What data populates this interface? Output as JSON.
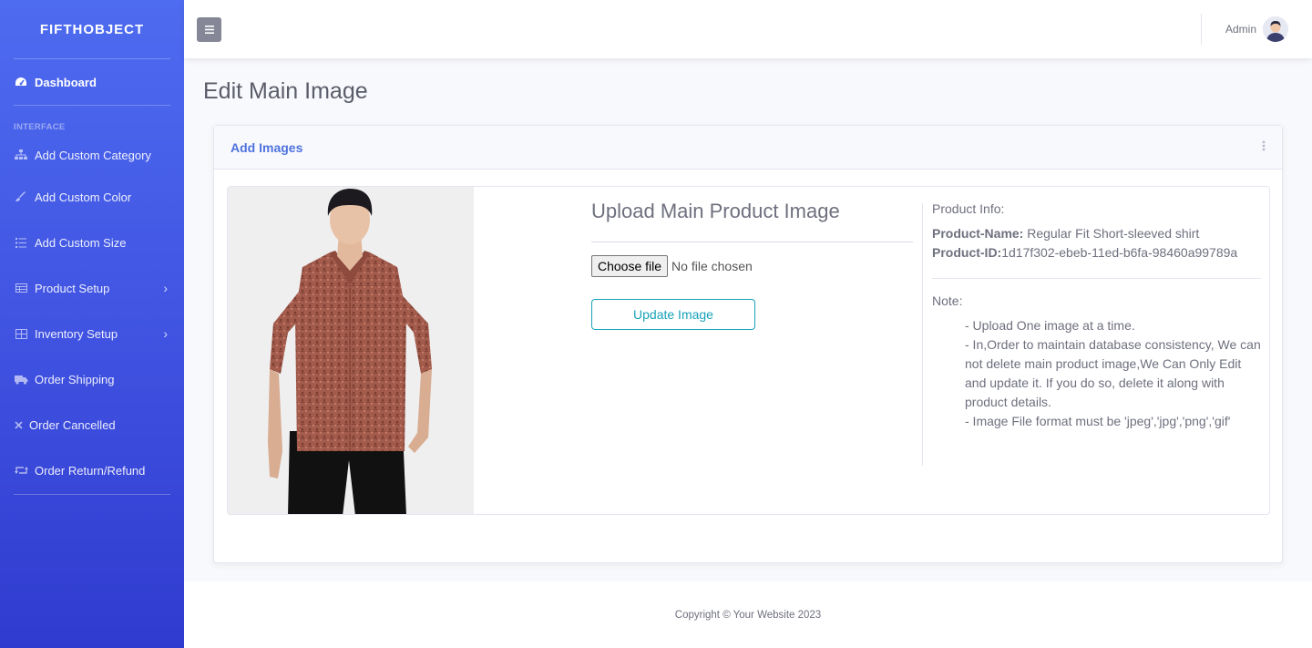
{
  "brand": "FIFTHOBJECT",
  "sidebar": {
    "dashboard": "Dashboard",
    "heading": "INTERFACE",
    "items": [
      {
        "label": "Add Custom Category",
        "icon": "sitemap-icon"
      },
      {
        "label": "Add Custom Color",
        "icon": "paint-brush-icon"
      },
      {
        "label": "Add Custom Size",
        "icon": "list-icon"
      },
      {
        "label": "Product Setup",
        "icon": "table-icon",
        "has_submenu": true
      },
      {
        "label": "Inventory Setup",
        "icon": "table-icon",
        "has_submenu": true
      },
      {
        "label": "Order Shipping",
        "icon": "truck-icon"
      },
      {
        "label": "Order Cancelled",
        "icon": "times-icon"
      },
      {
        "label": "Order Return/Refund",
        "icon": "retweet-icon"
      }
    ]
  },
  "topbar": {
    "user_name": "Admin"
  },
  "page": {
    "title": "Edit Main Image"
  },
  "card": {
    "title": "Add Images",
    "upload": {
      "title": "Upload Main Product Image",
      "choose_label": "Choose file",
      "no_file_label": "No file chosen",
      "update_label": "Update Image"
    },
    "info": {
      "heading": "Product Info:",
      "name_label": "Product-Name:",
      "name_value": " Regular Fit Short-sleeved shirt",
      "id_label": "Product-ID:",
      "id_value": "1d17f302-ebeb-11ed-b6fa-98460a99789a",
      "note_heading": "Note:",
      "notes": [
        "- Upload One image at a time.",
        "- In,Order to maintain database consistency, We can not delete main product image,We Can Only Edit and update it. If you do so, delete it along with product details.",
        "- Image File format must be 'jpeg','jpg','png','gif'"
      ]
    }
  },
  "footer": {
    "copyright": "Copyright © Your Website 2023"
  },
  "colors": {
    "sidebar_top": "#4e6cf0",
    "sidebar_bottom": "#2f3bcf",
    "accent": "#4e73df",
    "info_button": "#17a2b8",
    "shirt": "#a35b4c"
  }
}
